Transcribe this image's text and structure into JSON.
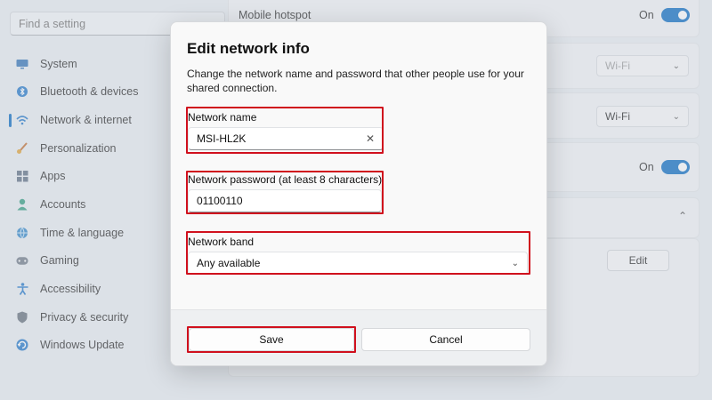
{
  "search": {
    "placeholder": "Find a setting"
  },
  "sidebar": {
    "items": [
      {
        "label": "System",
        "icon": "monitor-icon"
      },
      {
        "label": "Bluetooth & devices",
        "icon": "bluetooth-icon"
      },
      {
        "label": "Network & internet",
        "icon": "wifi-icon",
        "active": true
      },
      {
        "label": "Personalization",
        "icon": "brush-icon"
      },
      {
        "label": "Apps",
        "icon": "apps-icon"
      },
      {
        "label": "Accounts",
        "icon": "person-icon"
      },
      {
        "label": "Time & language",
        "icon": "globe-icon"
      },
      {
        "label": "Gaming",
        "icon": "controller-icon"
      },
      {
        "label": "Accessibility",
        "icon": "accessibility-icon"
      },
      {
        "label": "Privacy & security",
        "icon": "shield-icon"
      },
      {
        "label": "Windows Update",
        "icon": "update-icon"
      }
    ]
  },
  "background": {
    "hotspot_label": "Mobile hotspot",
    "hotspot_state": "On",
    "share_from_value": "Wi-Fi",
    "share_over_value": "Wi-Fi",
    "power_saving_state": "On",
    "edit_label": "Edit"
  },
  "dialog": {
    "title": "Edit network info",
    "description": "Change the network name and password that other people use for your shared connection.",
    "network_name": {
      "label": "Network name",
      "value": "MSI-HL2K"
    },
    "network_password": {
      "label": "Network password (at least 8 characters)",
      "value": "01100110"
    },
    "network_band": {
      "label": "Network band",
      "value": "Any available"
    },
    "save_label": "Save",
    "cancel_label": "Cancel"
  },
  "colors": {
    "accent": "#0067c0",
    "highlight": "#d0101d"
  }
}
